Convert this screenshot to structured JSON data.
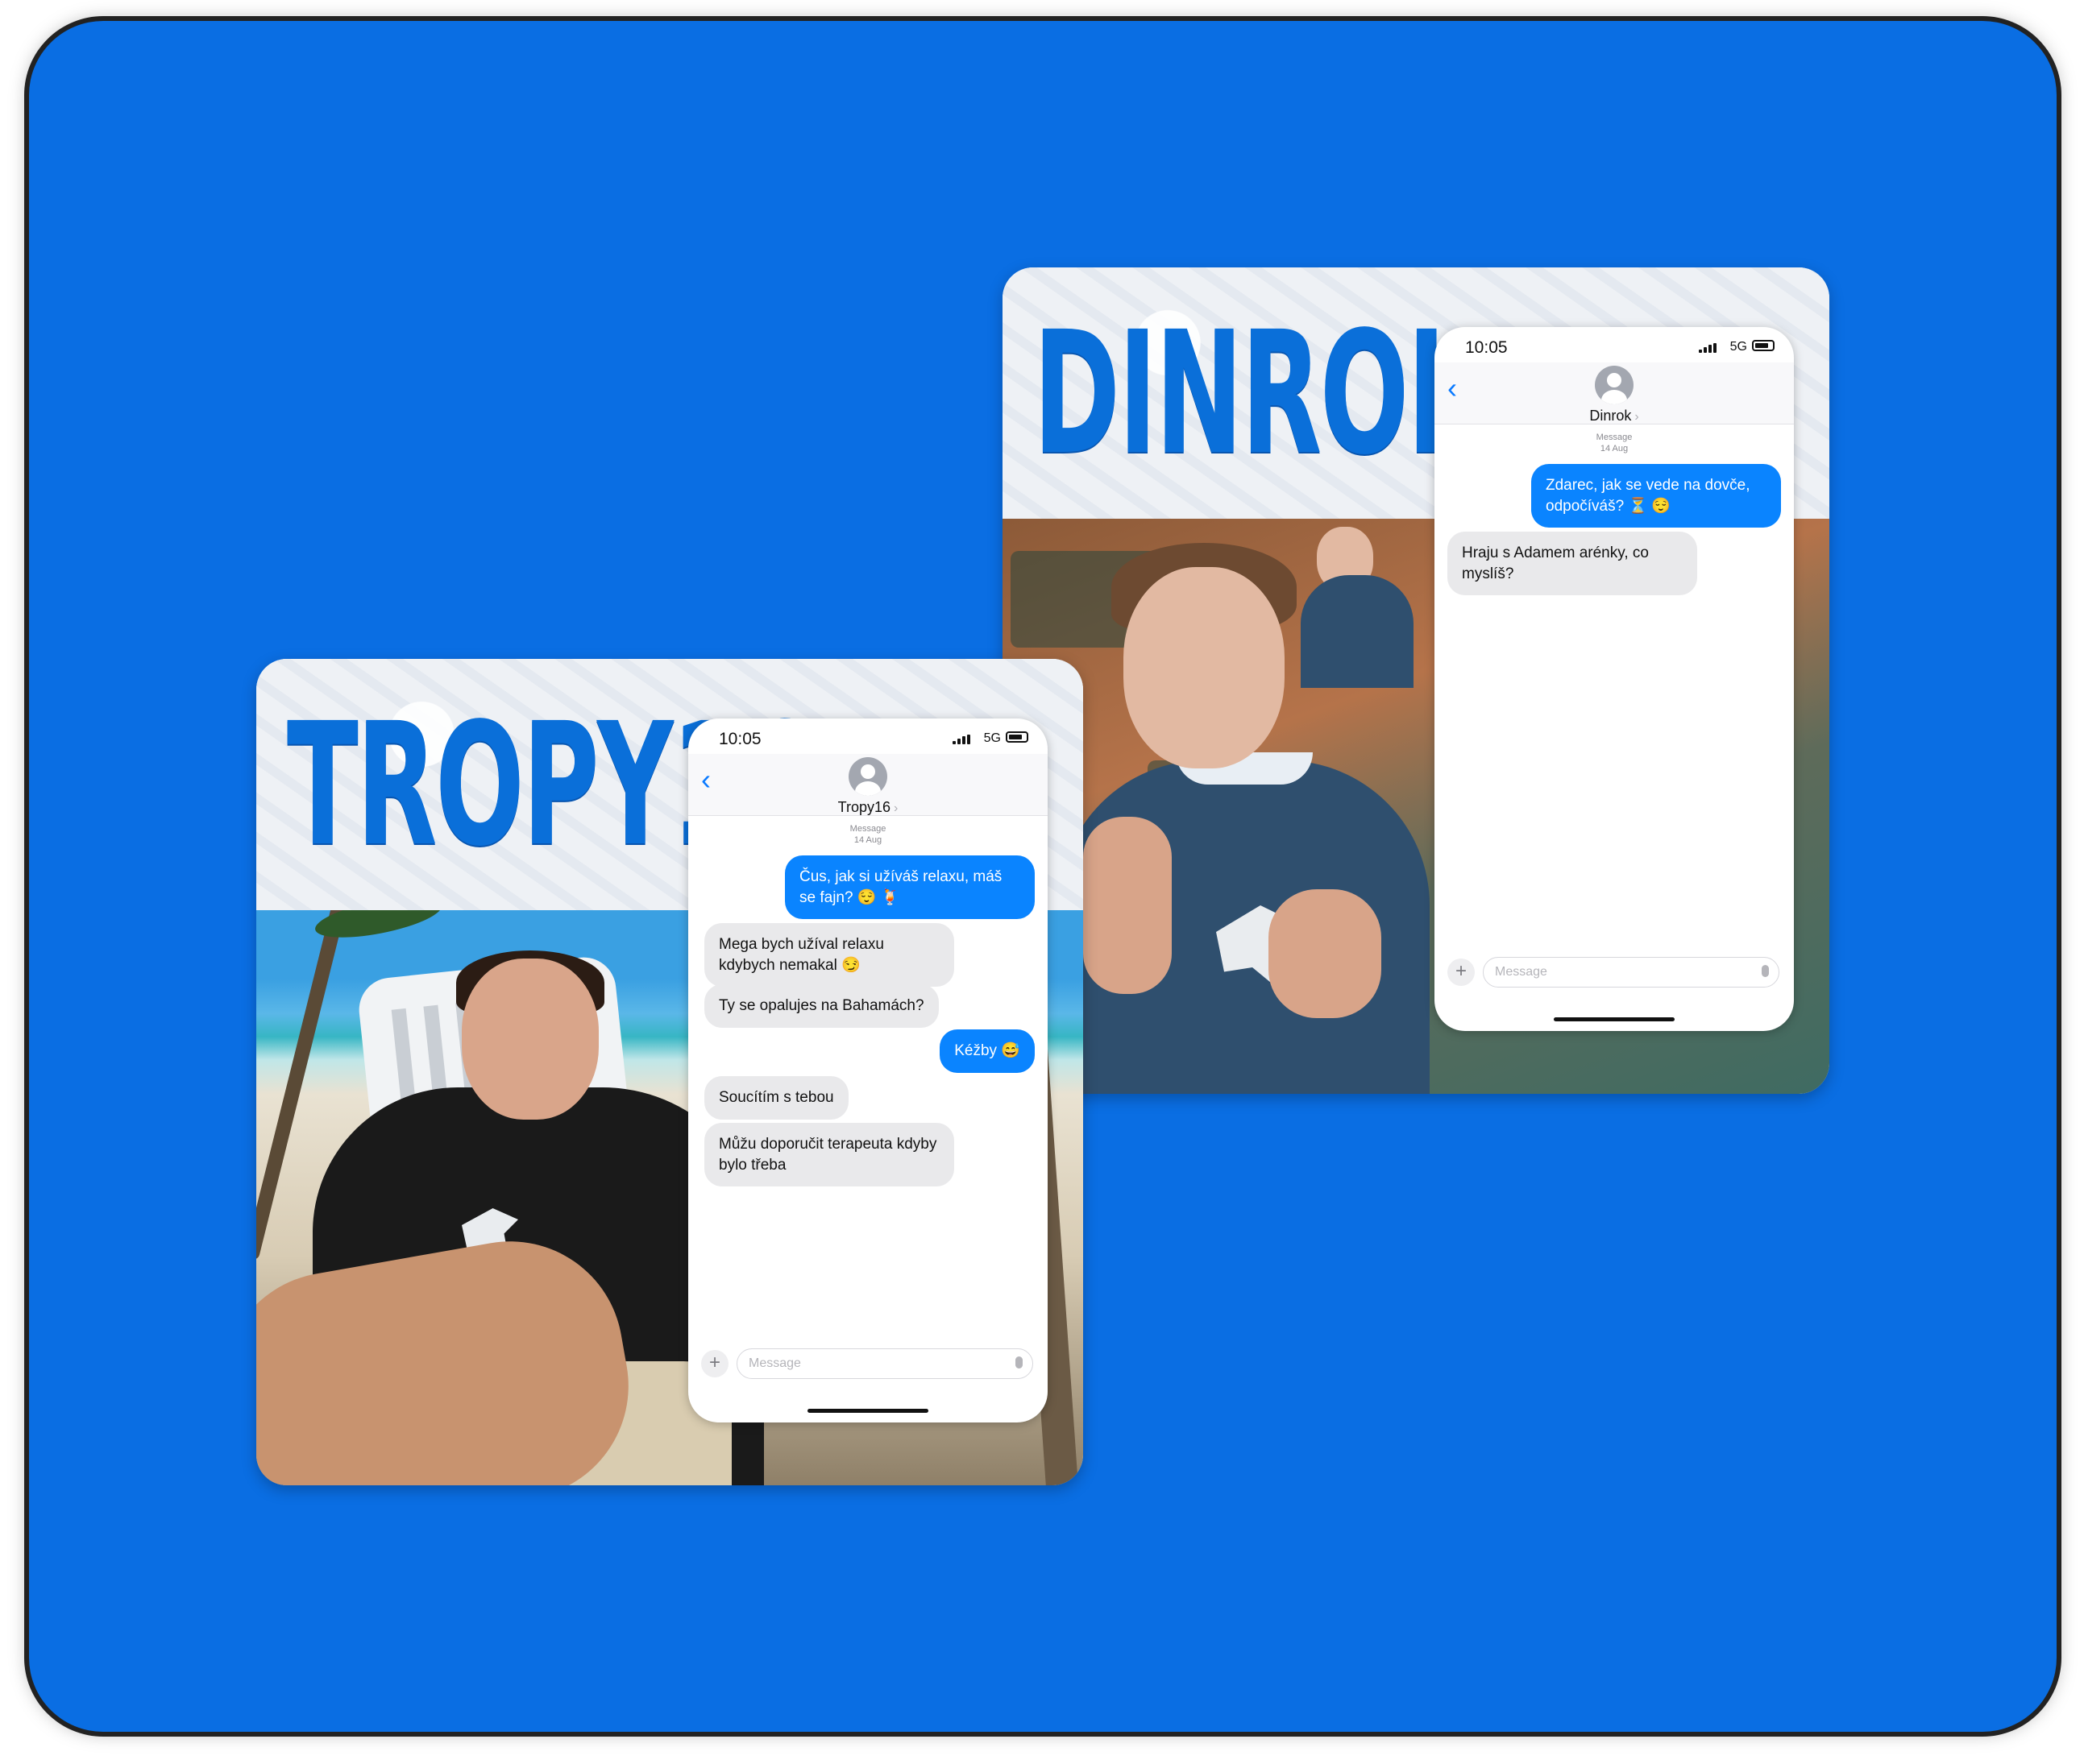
{
  "cards": [
    {
      "id": "dinrok",
      "banner_title": "DINROK",
      "phone": {
        "time": "10:05",
        "network": "5G",
        "back_icon": "chevron-left-icon",
        "contact_name": "Dinrok",
        "meta_line1": "Message",
        "meta_line2": "14 Aug",
        "messages": [
          {
            "from": "me",
            "text": "Zdarec, jak se vede na dovče, odpočíváš? ⏳ 😌"
          },
          {
            "from": "them",
            "text": "Hraju s Adamem arénky, co myslíš?"
          }
        ],
        "composer_placeholder": "Message"
      }
    },
    {
      "id": "tropy16",
      "banner_title": "TROPY16",
      "phone": {
        "time": "10:05",
        "network": "5G",
        "back_icon": "chevron-left-icon",
        "contact_name": "Tropy16",
        "meta_line1": "Message",
        "meta_line2": "14 Aug",
        "messages": [
          {
            "from": "me",
            "text": "Čus, jak si užíváš relaxu, máš se fajn? 😌 🍹"
          },
          {
            "from": "them",
            "text": "Mega bych užíval relaxu kdybych nemakal 😏"
          },
          {
            "from": "them",
            "text": "Ty se opalujes na Bahamách?"
          },
          {
            "from": "me",
            "text": "Kéžby 😅"
          },
          {
            "from": "them",
            "text": "Soucítím s tebou"
          },
          {
            "from": "them",
            "text": "Můžu doporučit terapeuta kdyby bylo třeba"
          }
        ],
        "composer_placeholder": "Message"
      }
    }
  ],
  "colors": {
    "background": "#0a6ee3",
    "title": "#0a6fd9",
    "sent_bubble": "#0a84ff",
    "received_bubble": "#e9e9eb"
  }
}
